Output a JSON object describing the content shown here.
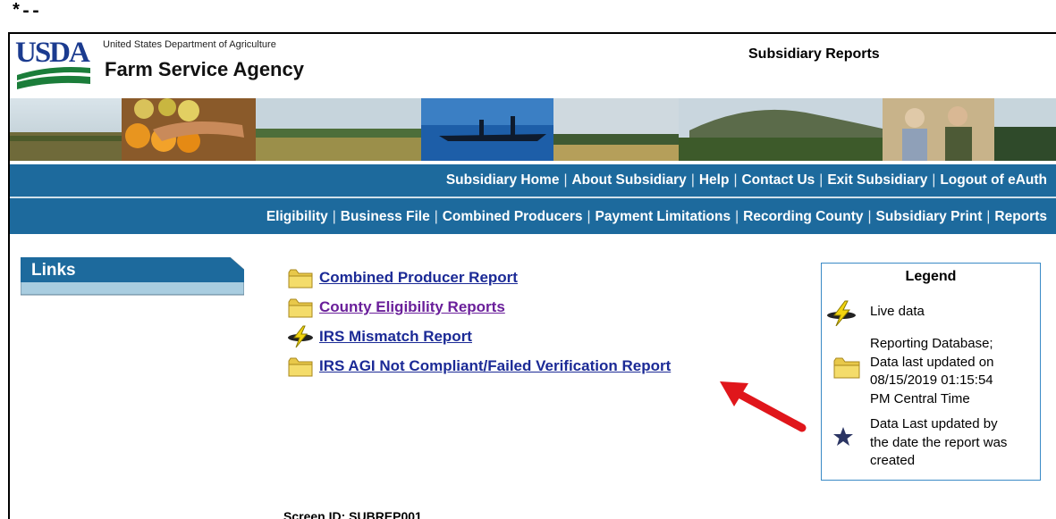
{
  "page_marker": "*--",
  "header": {
    "logo_text": "USDA",
    "department": "United States Department of Agriculture",
    "agency": "Farm Service Agency",
    "page_title": "Subsidiary Reports"
  },
  "nav_primary": [
    "Subsidiary Home",
    "About Subsidiary",
    "Help",
    "Contact Us",
    "Exit Subsidiary",
    "Logout of eAuth"
  ],
  "nav_secondary": [
    "Eligibility",
    "Business File",
    "Combined Producers",
    "Payment Limitations",
    "Recording County",
    "Subsidiary Print",
    "Reports"
  ],
  "sidebar": {
    "links_label": "Links"
  },
  "reports": [
    {
      "label": "Combined Producer Report",
      "icon": "folder-icon",
      "visited": false
    },
    {
      "label": "County Eligibility Reports",
      "icon": "folder-icon",
      "visited": true
    },
    {
      "label": "IRS Mismatch Report",
      "icon": "lightning-icon",
      "visited": false
    },
    {
      "label": "IRS AGI Not Compliant/Failed Verification Report",
      "icon": "folder-icon",
      "visited": false
    }
  ],
  "legend": {
    "title": "Legend",
    "items": [
      {
        "icon": "lightning-icon",
        "lines": [
          "Live data"
        ]
      },
      {
        "icon": "folder-icon",
        "lines": [
          "Reporting Database;",
          "Data last updated on",
          "08/15/2019 01:15:54",
          "PM Central Time"
        ]
      },
      {
        "icon": "star-icon",
        "lines": [
          "Data Last updated by",
          "the date the report was",
          "created"
        ]
      }
    ]
  },
  "screen_id": "Screen ID: SUBREP001",
  "colors": {
    "nav_bar": "#1d6a9d",
    "link": "#1b2a96",
    "visited_link": "#6a1f9a",
    "annotation_arrow": "#e0161b"
  }
}
